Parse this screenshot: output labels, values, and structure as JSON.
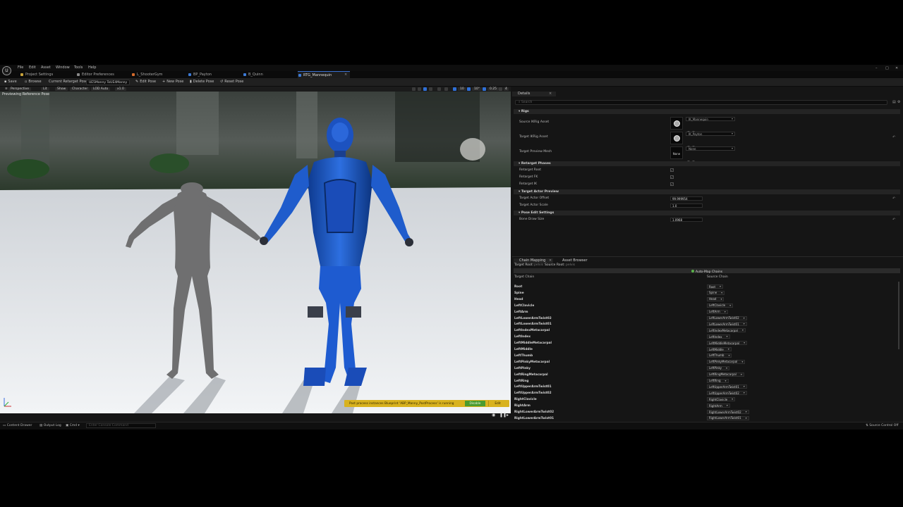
{
  "menu": {
    "logo": "U",
    "items": [
      "File",
      "Edit",
      "Asset",
      "Window",
      "Tools",
      "Help"
    ],
    "window_controls": [
      "–",
      "□",
      "✕"
    ]
  },
  "tabs": [
    {
      "label": "Project Settings",
      "color": "#c8a23a"
    },
    {
      "label": "Editor Preferences",
      "color": "#8a8a8a"
    },
    {
      "label": "L_ShooterGym",
      "color": "#d46a2b"
    },
    {
      "label": "BP_Payton",
      "color": "#3b7ad6"
    },
    {
      "label": "B_Quinn",
      "color": "#3b7ad6"
    },
    {
      "label": "RTG_Mannequin",
      "color": "#3b7ad6"
    }
  ],
  "toolbar": {
    "save": "Save",
    "browse": "Browse",
    "current_pose_label": "Current Retarget Pose:",
    "current_pose_value": "UE5Manny ToUE4Manny",
    "edit_pose": "Edit Pose",
    "new_pose": "New Pose",
    "delete_pose": "Delete Pose",
    "reset_pose": "Reset Pose"
  },
  "viewport": {
    "perspective": "Perspective",
    "lit": "Lit",
    "show": "Show",
    "character": "Character",
    "lod": "LOD Auto",
    "speed": "x1.0",
    "previewing": "Previewing Reference Pose",
    "grid_snap": "10",
    "rot_snap": "10°",
    "scale_snap": "0.25",
    "cam_speed": "4",
    "notification": "Post process instances Blueprint 'ABP_Manny_PostProcess' is running",
    "disable": "Disable",
    "edit": "Edit"
  },
  "details": {
    "tab": "Details",
    "search_placeholder": "Search",
    "cat_rigs": "Rigs",
    "source_ik_rig_label": "Source IKRig Asset",
    "source_ik_rig_value": "IK_Mannequin",
    "target_ik_rig_label": "Target IKRig Asset",
    "target_ik_rig_value": "IK_Payton",
    "target_preview_mesh_label": "Target Preview Mesh",
    "target_preview_mesh_value": "None",
    "preview_thumb": "None",
    "cat_phases": "Retarget Phases",
    "retarget_root": "Retarget Root",
    "retarget_fk": "Retarget FK",
    "retarget_ik": "Retarget IK",
    "cat_actor_preview": "Target Actor Preview",
    "actor_offset_label": "Target Actor Offset",
    "actor_offset_value": "99.999954",
    "actor_scale_label": "Target Actor Scale",
    "actor_scale_value": "1.0",
    "cat_pose_edit": "Pose Edit Settings",
    "bone_draw_label": "Bone Draw Size",
    "bone_draw_value": "1.0968"
  },
  "chain_panel": {
    "tab_chain": "Chain Mapping",
    "tab_browser": "Asset Browser",
    "target_root_label": "Target Root:",
    "target_root_value": "pelvis",
    "source_root_label": "Source Root:",
    "source_root_value": "pelvis",
    "automap": "Auto-Map Chains",
    "col_target": "Target Chain",
    "col_source": "Source Chain",
    "rows": [
      {
        "t": "Root",
        "s": "Root"
      },
      {
        "t": "Spine",
        "s": "Spine"
      },
      {
        "t": "Head",
        "s": "Head"
      },
      {
        "t": "LeftClavicle",
        "s": "LeftClavicle"
      },
      {
        "t": "LeftArm",
        "s": "LeftArm"
      },
      {
        "t": "LeftLowerArmTwist02",
        "s": "LeftLowerArmTwist02"
      },
      {
        "t": "LeftLowerArmTwist01",
        "s": "LeftLowerArmTwist01"
      },
      {
        "t": "LeftIndexMetacarpal",
        "s": "LeftIndexMetacarpal"
      },
      {
        "t": "LeftIndex",
        "s": "LeftIndex"
      },
      {
        "t": "LeftMiddleMetacarpal",
        "s": "LeftMiddleMetacarpal"
      },
      {
        "t": "LeftMiddle",
        "s": "LeftMiddle"
      },
      {
        "t": "LeftThumb",
        "s": "LeftThumb"
      },
      {
        "t": "LeftPinkyMetacarpal",
        "s": "LeftPinkyMetacarpal"
      },
      {
        "t": "LeftPinky",
        "s": "LeftPinky"
      },
      {
        "t": "LeftRingMetacarpal",
        "s": "LeftRingMetacarpal"
      },
      {
        "t": "LeftRing",
        "s": "LeftRing"
      },
      {
        "t": "LeftUpperArmTwist01",
        "s": "LeftUpperArmTwist01"
      },
      {
        "t": "LeftUpperArmTwist02",
        "s": "LeftUpperArmTwist02"
      },
      {
        "t": "RightClavicle",
        "s": "RightClavicle"
      },
      {
        "t": "RightArm",
        "s": "RightArm"
      },
      {
        "t": "RightLowerArmTwist02",
        "s": "RightLowerArmTwist02"
      },
      {
        "t": "RightLowerArmTwist01",
        "s": "RightLowerArmTwist01"
      }
    ]
  },
  "drawer": {
    "content_drawer": "Content Drawer",
    "output_log": "Output Log",
    "cmd": "Cmd",
    "console_placeholder": "Enter Console Command",
    "source_control": "Source Control Off"
  }
}
